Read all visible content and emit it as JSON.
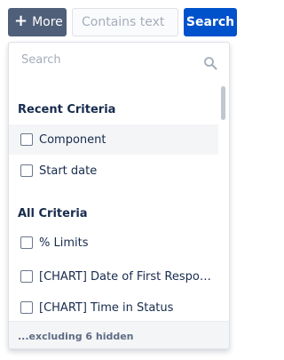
{
  "toolbar": {
    "more_icon": "plus-icon",
    "more_label": "More",
    "text_placeholder": "Contains text",
    "search_label": "Search"
  },
  "dropdown": {
    "search_placeholder": "Search",
    "search_icon": "search-icon",
    "groups": [
      {
        "title": "Recent Criteria",
        "items": [
          "Component",
          "Start date"
        ]
      },
      {
        "title": "All Criteria",
        "items": [
          "% Limits",
          "[CHART] Date of First Respo…",
          "[CHART] Time in Status"
        ]
      }
    ],
    "footer": "...excluding 6 hidden"
  },
  "colors": {
    "more_button": "#505f79",
    "search_button": "#0052cc",
    "highlight_row": "#f4f5f7"
  }
}
